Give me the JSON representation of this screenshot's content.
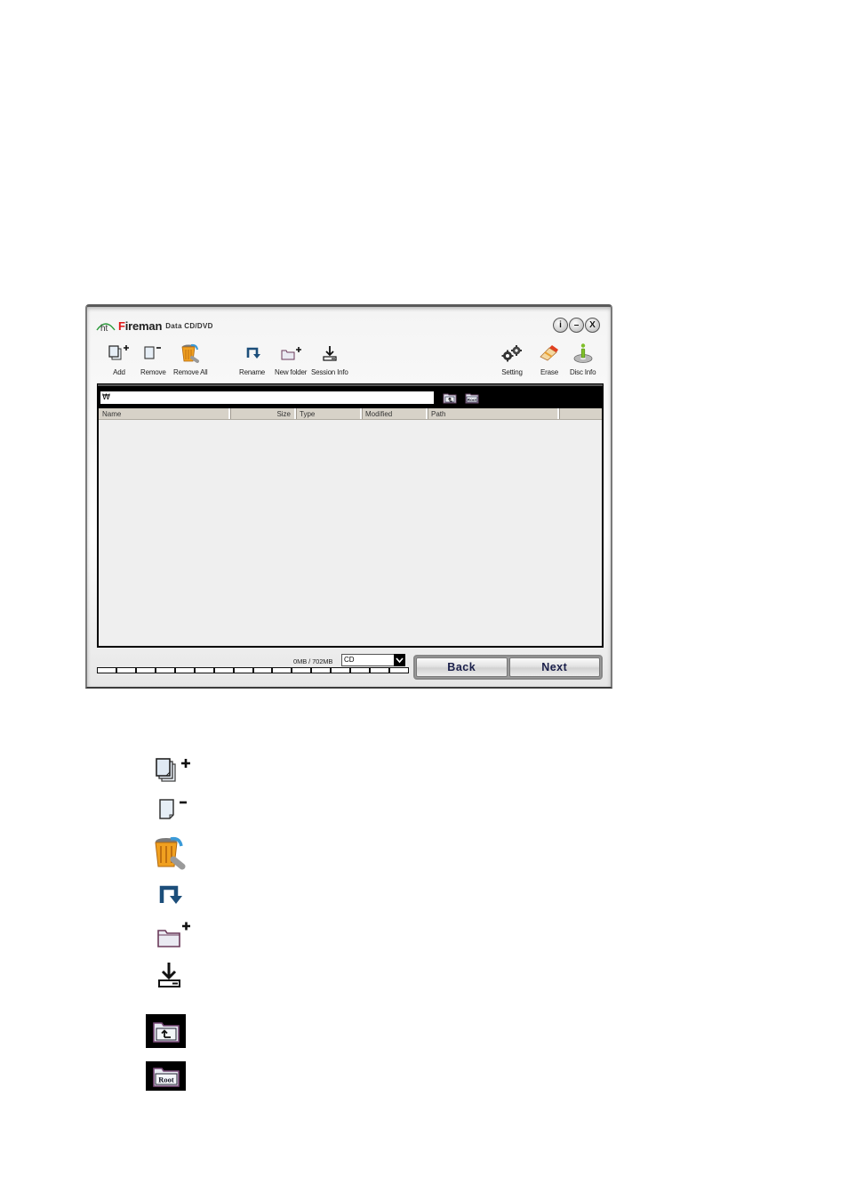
{
  "window": {
    "logo": "ht",
    "title_brand": "Fireman",
    "title_sub": "Data CD/DVD",
    "controls": [
      {
        "name": "info",
        "glyph": "i"
      },
      {
        "name": "minimize",
        "glyph": "–"
      },
      {
        "name": "close",
        "glyph": "X"
      }
    ]
  },
  "toolbar": {
    "add": {
      "label": "Add",
      "icon": "add-files-icon"
    },
    "remove": {
      "label": "Remove",
      "icon": "remove-file-icon"
    },
    "remove_all": {
      "label": "Remove All",
      "icon": "trash-bin-icon"
    },
    "rename": {
      "label": "Rename",
      "icon": "rename-icon"
    },
    "new_folder": {
      "label": "New folder",
      "icon": "new-folder-icon"
    },
    "session_info": {
      "label": "Session Info",
      "icon": "session-info-icon"
    },
    "setting": {
      "label": "Setting",
      "icon": "gears-icon"
    },
    "erase": {
      "label": "Erase",
      "icon": "eraser-icon"
    },
    "disc_info": {
      "label": "Disc Info",
      "icon": "disc-info-icon"
    }
  },
  "path_bar": {
    "current_path": "₩",
    "up_button": "folder-up-icon",
    "root_button": "folder-root-icon",
    "root_label": "Root"
  },
  "file_list": {
    "columns": [
      "Name",
      "Size",
      "Type",
      "Modified",
      "Path",
      ""
    ],
    "rows": []
  },
  "status": {
    "capacity_text": "0MB / 702MB",
    "used_fraction": 0,
    "media_type": "CD"
  },
  "nav": {
    "back_label": "Back",
    "next_label": "Next"
  },
  "legend": {
    "icons": [
      "add-files-icon",
      "remove-file-icon",
      "trash-bin-icon",
      "rename-icon",
      "new-folder-icon",
      "session-info-icon",
      "folder-up-icon",
      "folder-root-icon"
    ]
  }
}
